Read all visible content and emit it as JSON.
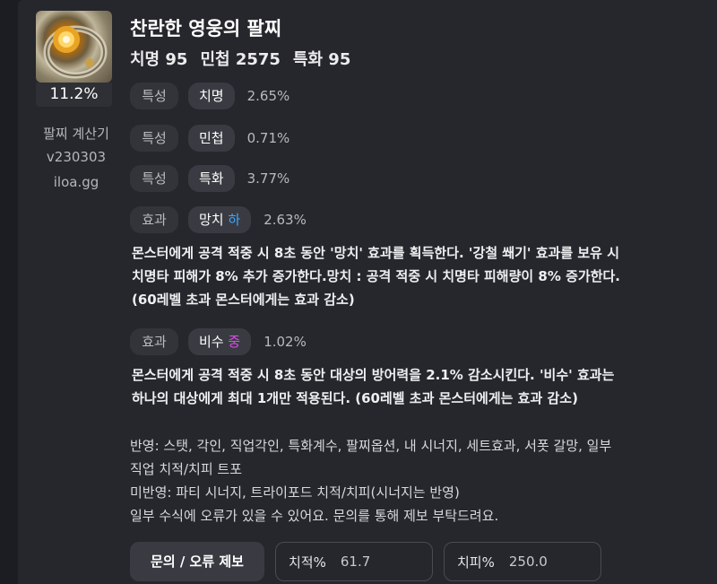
{
  "item": {
    "name": "찬란한 영웅의 팔찌",
    "stats": [
      "치명 95",
      "민첩 2575",
      "특화 95"
    ],
    "percent_badge": "11.2%",
    "icon": "bracelet-icon"
  },
  "sidebar": {
    "calculator_label": "팔찌 계산기",
    "version": "v230303",
    "site": "iloa.gg"
  },
  "rows": [
    {
      "type": "특성",
      "name": "치명",
      "grade": "",
      "value": "2.65%"
    },
    {
      "type": "특성",
      "name": "민첩",
      "grade": "",
      "value": "0.71%"
    },
    {
      "type": "특성",
      "name": "특화",
      "grade": "",
      "value": "3.77%"
    },
    {
      "type": "효과",
      "name": "망치",
      "grade": "하",
      "value": "2.63%",
      "description": [
        "몬스터에게 공격 적중 시 8초 동안 '망치' 효과를 획득한다. '강철 쐐기' 효과를 보유 시",
        "치명타 피해가 8% 추가 증가한다.망치 : 공격 적중 시 치명타 피해량이 8% 증가한다.",
        "(60레벨 초과 몬스터에게는 효과 감소)"
      ]
    },
    {
      "type": "효과",
      "name": "비수",
      "grade": "중",
      "value": "1.02%",
      "description": [
        "몬스터에게 공격 적중 시 8초 동안 대상의 방어력을 2.1% 감소시킨다. '비수' 효과는",
        "하나의 대상에게 최대 1개만 적용된다. (60레벨 초과 몬스터에게는 효과 감소)"
      ]
    }
  ],
  "notes": [
    "반영: 스탯, 각인, 직업각인, 특화계수, 팔찌옵션, 내 시너지, 세트효과, 서폿 갈망, 일부",
    "직업 치적/치피 트포",
    "미반영: 파티 시너지, 트라이포드 치적/치피(시너지는 반영)",
    "일부 수식에 오류가 있을 수 있어요. 문의를 통해 제보 부탁드려요."
  ],
  "controls": {
    "report_button": "문의 / 오류 제보",
    "crit_rate_label": "치적%",
    "crit_rate_value": "61.7",
    "crit_dmg_label": "치피%",
    "crit_dmg_value": "250.0"
  },
  "colors": {
    "grade_low": "#3aa8ff",
    "grade_mid": "#d84ee6",
    "background": "#26272c"
  }
}
